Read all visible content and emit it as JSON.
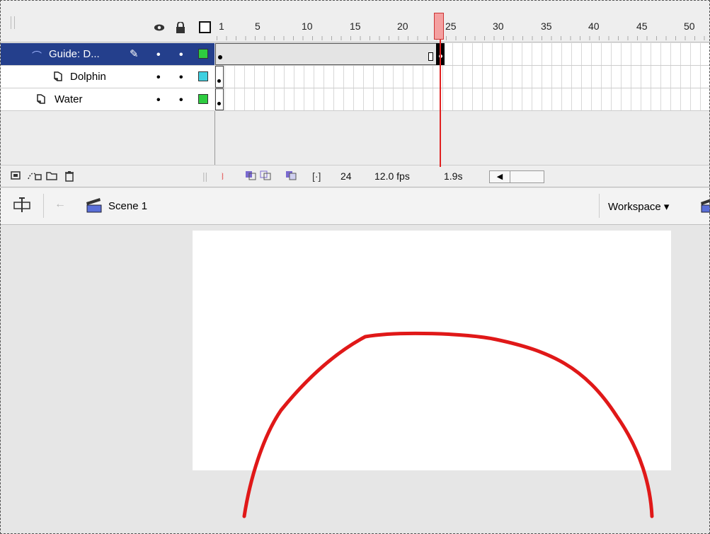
{
  "timeline": {
    "header_icons": [
      "eye-icon",
      "lock-icon",
      "outline-icon"
    ],
    "ruler": [
      "1",
      "5",
      "10",
      "15",
      "20",
      "25",
      "30",
      "35",
      "40",
      "45",
      "50"
    ],
    "current_frame": "24",
    "layers": [
      {
        "name": "Guide: D...",
        "icon": "motion-guide-icon",
        "selected": true,
        "outline_color": "#2ecc40",
        "visible": "•",
        "locked": "•"
      },
      {
        "name": "Dolphin",
        "icon": "guided-layer-icon",
        "selected": false,
        "outline_color": "#3fd0e0",
        "visible": "•",
        "locked": "•"
      },
      {
        "name": "Water",
        "icon": "layer-icon",
        "selected": false,
        "outline_color": "#2ecc40",
        "visible": "•",
        "locked": "•"
      }
    ],
    "footer": {
      "current_frame": "24",
      "frame_rate": "12.0 fps",
      "elapsed_time": "1.9s"
    }
  },
  "edit_bar": {
    "scene": "Scene 1",
    "workspace": "Workspace ▾"
  },
  "colors": {
    "selected_layer": "#243f8c",
    "playhead": "#e02020",
    "guide_path": "#e01818"
  }
}
